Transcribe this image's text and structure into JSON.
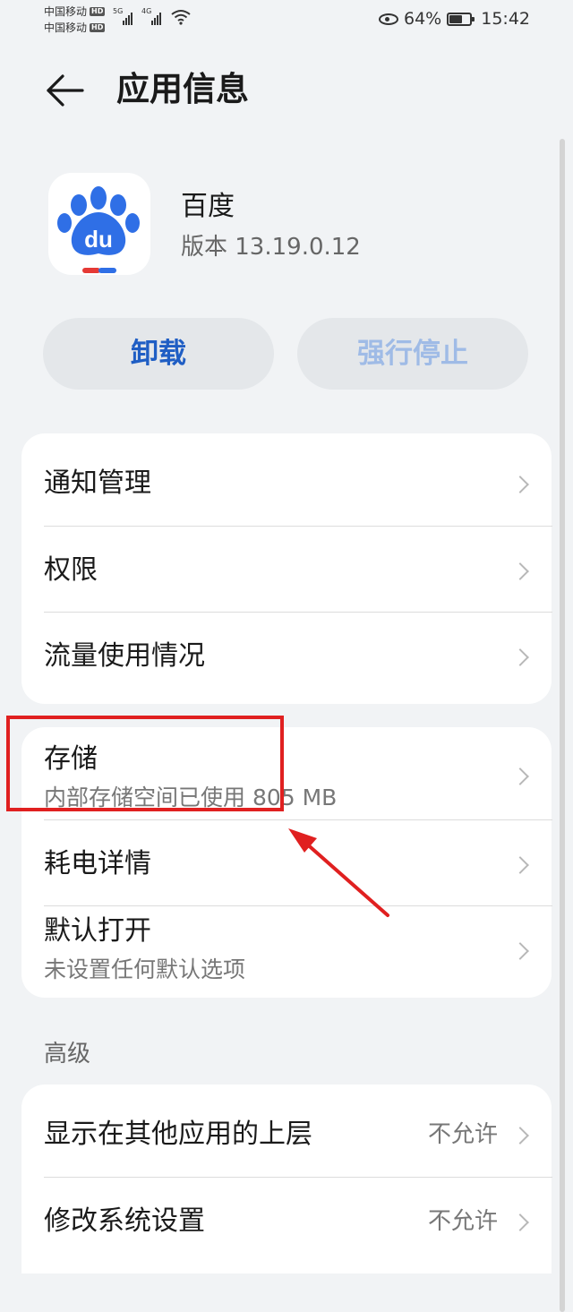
{
  "status_bar": {
    "carrier1": "中国移动",
    "carrier2": "中国移动",
    "hd_badge": "HD",
    "network1": "5G",
    "network2": "4G",
    "battery_percent": "64%",
    "time": "15:42"
  },
  "header": {
    "title": "应用信息"
  },
  "app": {
    "name": "百度",
    "version": "版本 13.19.0.12",
    "icon_text": "du",
    "brand_color": "#2f6fe6",
    "bar_red": "#e53935"
  },
  "actions": {
    "uninstall_label": "卸载",
    "force_stop_label": "强行停止"
  },
  "card1": {
    "items": [
      {
        "label": "通知管理"
      },
      {
        "label": "权限"
      },
      {
        "label": "流量使用情况"
      }
    ]
  },
  "card2": {
    "items": [
      {
        "label": "存储",
        "sub": "内部存储空间已使用 805 MB"
      },
      {
        "label": "耗电详情"
      },
      {
        "label": "默认打开",
        "sub": "未设置任何默认选项"
      }
    ]
  },
  "advanced": {
    "section_label": "高级",
    "items": [
      {
        "label": "显示在其他应用的上层",
        "value": "不允许"
      },
      {
        "label": "修改系统设置",
        "value": "不允许"
      }
    ]
  },
  "annotation_color": "#e02020"
}
